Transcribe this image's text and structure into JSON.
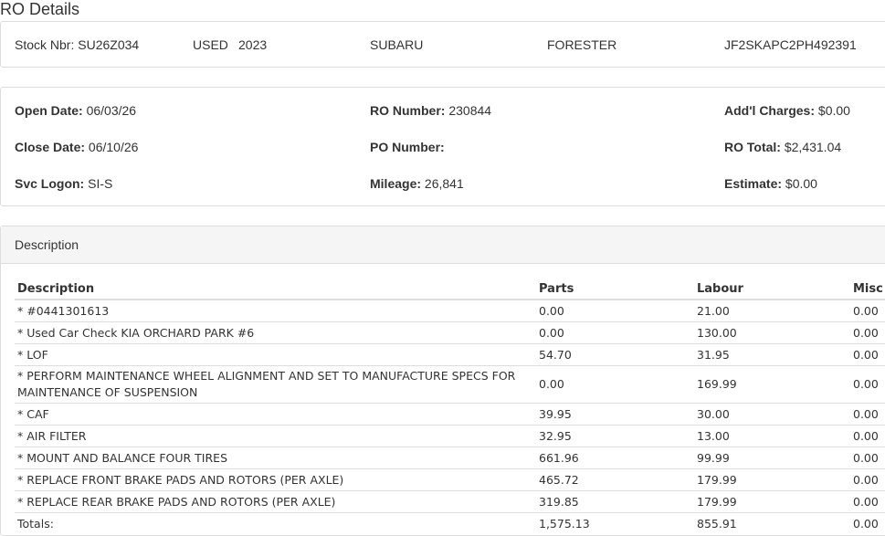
{
  "page_title": "RO Details",
  "vehicle": {
    "stock": "Stock Nbr: SU26Z034",
    "condition": "USED",
    "year": "2023",
    "make": "SUBARU",
    "model": "FORESTER",
    "vin": "JF2SKAPC2PH492391"
  },
  "info": {
    "open_date_label": "Open Date:",
    "open_date": "06/03/26",
    "close_date_label": "Close Date:",
    "close_date": "06/10/26",
    "svc_logon_label": "Svc Logon:",
    "svc_logon": "SI-S",
    "ro_number_label": "RO Number:",
    "ro_number": "230844",
    "po_number_label": "PO Number:",
    "po_number": "",
    "mileage_label": "Mileage:",
    "mileage": "26,841",
    "addl_charges_label": "Add'l Charges:",
    "addl_charges": "$0.00",
    "ro_total_label": "RO Total:",
    "ro_total": "$2,431.04",
    "estimate_label": "Estimate:",
    "estimate": "$0.00"
  },
  "description_panel": {
    "heading": "Description",
    "columns": [
      "Description",
      "Parts",
      "Labour",
      "Misc"
    ],
    "rows": [
      {
        "desc": "* #0441301613",
        "parts": "0.00",
        "labour": "21.00",
        "misc": "0.00"
      },
      {
        "desc": "* Used Car Check KIA ORCHARD PARK #6",
        "parts": "0.00",
        "labour": "130.00",
        "misc": "0.00"
      },
      {
        "desc": "* LOF",
        "parts": "54.70",
        "labour": "31.95",
        "misc": "0.00"
      },
      {
        "desc": "* PERFORM MAINTENANCE WHEEL ALIGNMENT AND SET TO MANUFACTURE SPECS FOR MAINTENANCE OF SUSPENSION",
        "parts": "0.00",
        "labour": "169.99",
        "misc": "0.00"
      },
      {
        "desc": "* CAF",
        "parts": "39.95",
        "labour": "30.00",
        "misc": "0.00"
      },
      {
        "desc": "* AIR FILTER",
        "parts": "32.95",
        "labour": "13.00",
        "misc": "0.00"
      },
      {
        "desc": "* MOUNT AND BALANCE FOUR TIRES",
        "parts": "661.96",
        "labour": "99.99",
        "misc": "0.00"
      },
      {
        "desc": "* REPLACE FRONT BRAKE PADS AND ROTORS (PER AXLE)",
        "parts": "465.72",
        "labour": "179.99",
        "misc": "0.00"
      },
      {
        "desc": "* REPLACE REAR BRAKE PADS AND ROTORS (PER AXLE)",
        "parts": "319.85",
        "labour": "179.99",
        "misc": "0.00"
      }
    ],
    "totals": {
      "label": "Totals:",
      "parts": "1,575.13",
      "labour": "855.91",
      "misc": "0.00"
    }
  }
}
